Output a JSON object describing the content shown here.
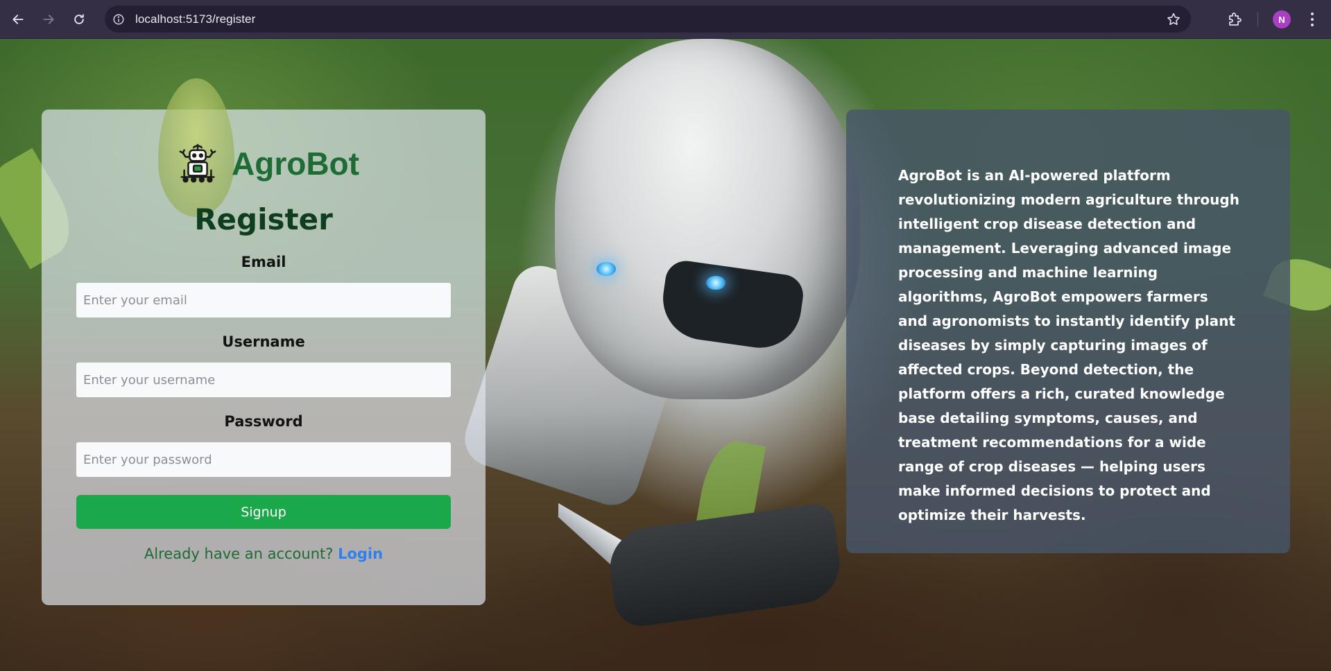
{
  "browser": {
    "url": "localhost:5173/register",
    "profile_initial": "N",
    "back_icon": "arrow-left-icon",
    "forward_icon": "arrow-right-icon",
    "reload_icon": "reload-icon",
    "site_info_icon": "info-icon",
    "bookmark_icon": "star-icon",
    "extensions_icon": "puzzle-icon",
    "menu_icon": "kebab-menu-icon"
  },
  "brand": {
    "name": "AgroBot",
    "name_color": "#1f6b35",
    "logo_icon": "robot-logo-icon"
  },
  "register_form": {
    "title": "Register",
    "email": {
      "label": "Email",
      "placeholder": "Enter your email",
      "value": ""
    },
    "username": {
      "label": "Username",
      "placeholder": "Enter your username",
      "value": ""
    },
    "password": {
      "label": "Password",
      "placeholder": "Enter your password",
      "value": ""
    },
    "submit_label": "Signup",
    "submit_color": "#1ba84b",
    "login_prompt": "Already have an account?",
    "login_link": "Login",
    "login_link_color": "#2f80ed"
  },
  "about": {
    "text": "AgroBot is an AI-powered platform revolutionizing modern agriculture through intelligent crop disease detection and management. Leveraging advanced image processing and machine learning algorithms, AgroBot empowers farmers and agronomists to instantly identify plant diseases by simply capturing images of affected crops. Beyond detection, the platform offers a rich, curated knowledge base detailing symptoms, causes, and treatment recommendations for a wide range of crop diseases — helping users make informed decisions to protect and optimize their harvests."
  }
}
